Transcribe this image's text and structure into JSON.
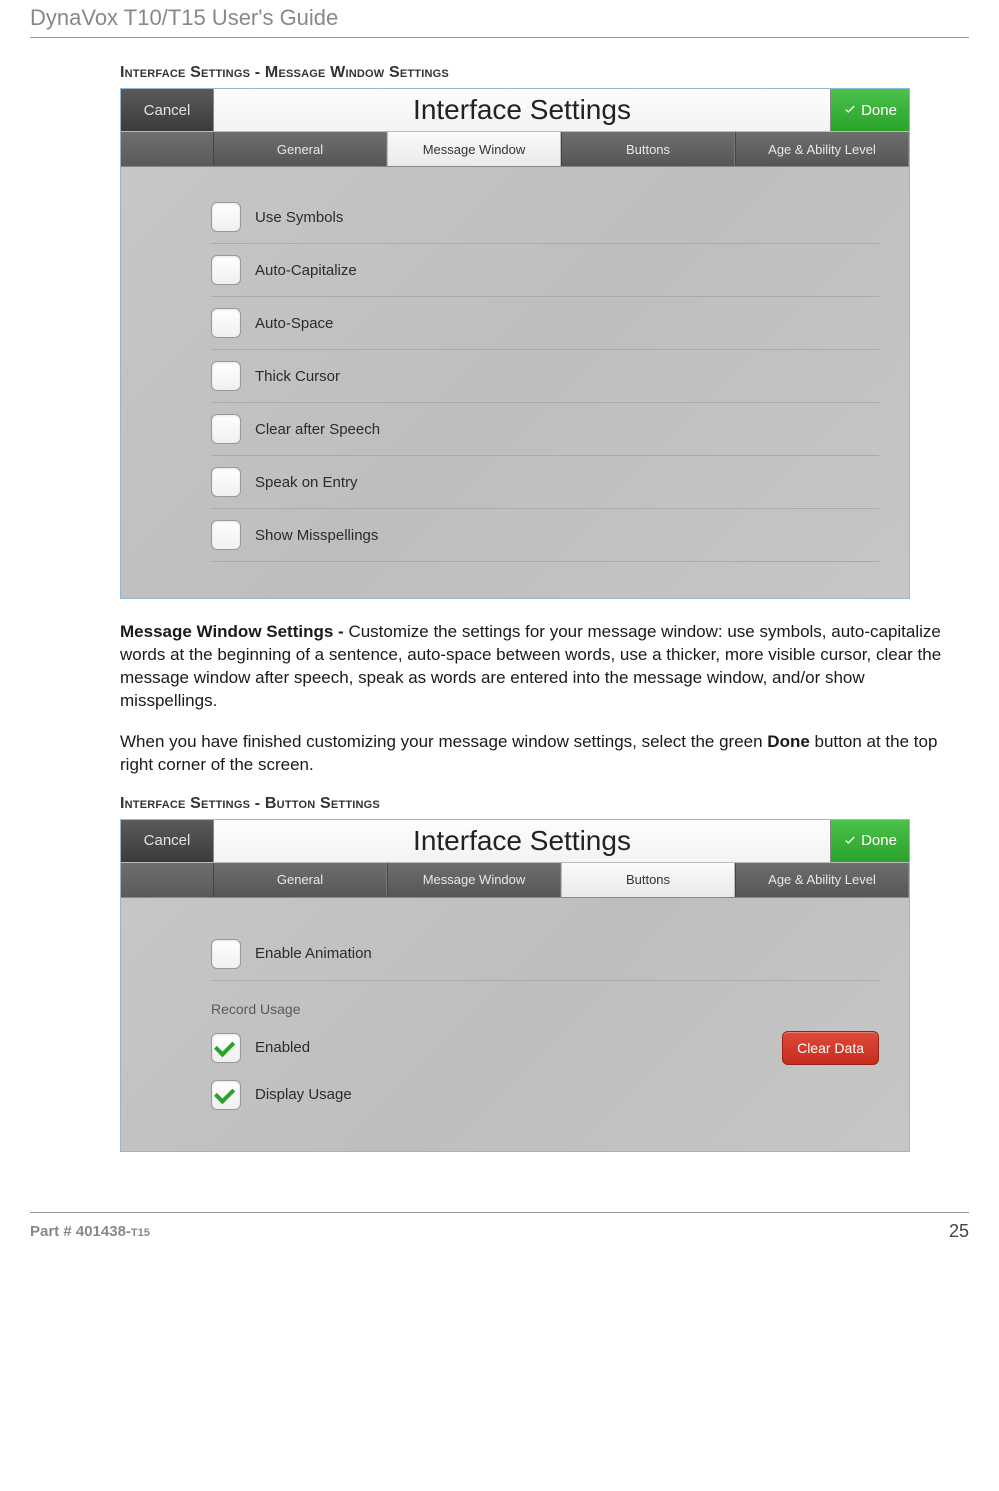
{
  "doc": {
    "header_title": "DynaVox T10/T15 User's Guide",
    "footer_part_label": "Part # 401438-",
    "footer_part_suffix": "T15",
    "footer_page": "25"
  },
  "section1": {
    "heading": "Interface Settings - Message Window Settings",
    "para1_bold": "Message Window Settings - ",
    "para1_rest": "Customize the settings for your message window: use symbols, auto-capitalize words at the beginning of a sentence, auto-space between words, use a thicker, more visible cursor, clear the message window after speech, speak as words are entered into the message window, and/or show misspellings.",
    "para2_pre": "When you have finished customizing your message window settings, select the green ",
    "para2_bold": "Done",
    "para2_post": " button at the top right corner of the screen."
  },
  "screenshot1": {
    "cancel": "Cancel",
    "title": "Interface Settings",
    "done": "Done",
    "tabs": [
      "General",
      "Message Window",
      "Buttons",
      "Age & Ability Level"
    ],
    "active_tab_index": 1,
    "rows": [
      {
        "label": "Use Symbols"
      },
      {
        "label": "Auto-Capitalize"
      },
      {
        "label": "Auto-Space"
      },
      {
        "label": "Thick Cursor"
      },
      {
        "label": "Clear after Speech"
      },
      {
        "label": "Speak on Entry"
      },
      {
        "label": "Show Misspellings"
      }
    ]
  },
  "section2": {
    "heading": "Interface Settings - Button Settings"
  },
  "screenshot2": {
    "cancel": "Cancel",
    "title": "Interface Settings",
    "done": "Done",
    "tabs": [
      "General",
      "Message Window",
      "Buttons",
      "Age & Ability Level"
    ],
    "active_tab_index": 2,
    "row_enable_animation": "Enable Animation",
    "subhead": "Record Usage",
    "row_enabled": "Enabled",
    "row_display_usage": "Display Usage",
    "clear_data_btn": "Clear Data"
  }
}
